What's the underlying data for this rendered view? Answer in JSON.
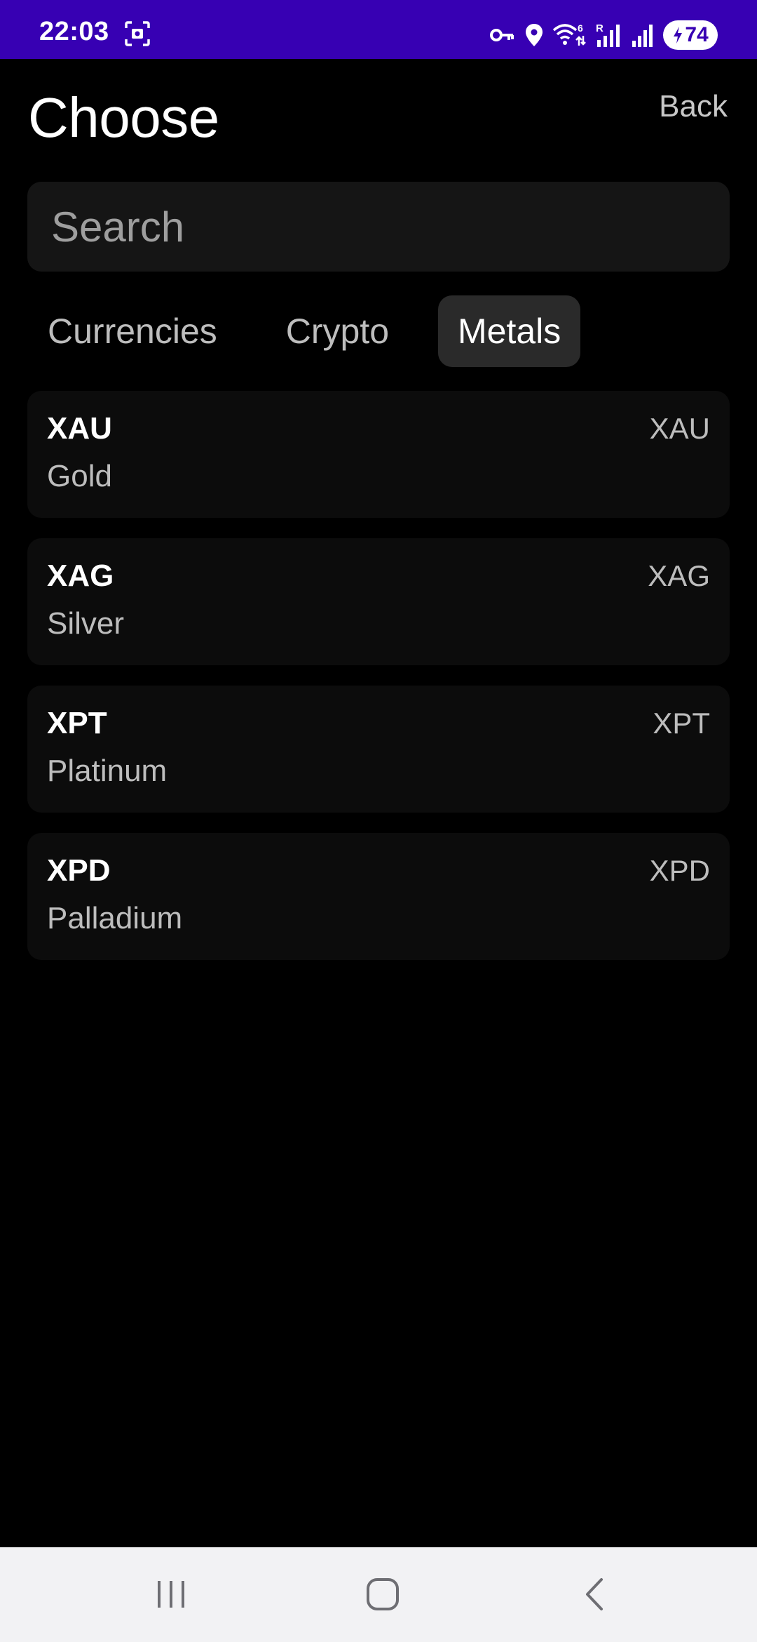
{
  "status_bar": {
    "time": "22:03",
    "battery": "74"
  },
  "header": {
    "title": "Choose",
    "back_label": "Back"
  },
  "search": {
    "placeholder": "Search",
    "value": ""
  },
  "tabs": [
    {
      "label": "Currencies",
      "active": false
    },
    {
      "label": "Crypto",
      "active": false
    },
    {
      "label": "Metals",
      "active": true
    }
  ],
  "items": [
    {
      "code": "XAU",
      "name": "Gold",
      "symbol": "XAU"
    },
    {
      "code": "XAG",
      "name": "Silver",
      "symbol": "XAG"
    },
    {
      "code": "XPT",
      "name": "Platinum",
      "symbol": "XPT"
    },
    {
      "code": "XPD",
      "name": "Palladium",
      "symbol": "XPD"
    }
  ],
  "icons": {
    "status_left": "screenshot-icon",
    "status_right": [
      "vpn-key-icon",
      "location-icon",
      "wifi-calling-icon",
      "signal-roaming-icon",
      "signal-icon",
      "battery-charging-icon"
    ],
    "nav": [
      "recents-icon",
      "home-icon",
      "back-icon"
    ]
  },
  "colors": {
    "status_bar": "#3700b3",
    "background": "#000000",
    "card": "#0c0c0c",
    "active_tab": "#2a2a2a",
    "nav_bar": "#f2f2f4"
  }
}
